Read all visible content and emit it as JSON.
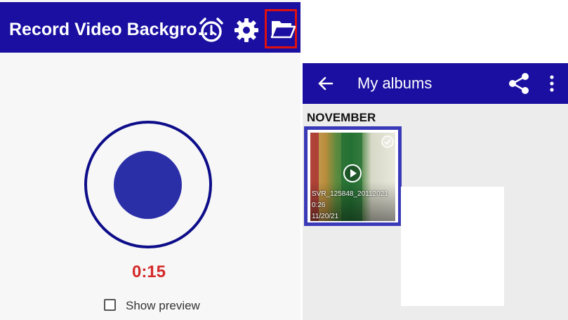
{
  "colors": {
    "appbar": "#1a0fa0",
    "record_ring": "#0d0d8a",
    "record_dot": "#2a2fa8",
    "timer": "#d42a2a",
    "highlight_red": "#e01010",
    "selection_blue": "#3a3ab8"
  },
  "recorder": {
    "title": "Record Video Backgro…",
    "icons": [
      "alarm-icon",
      "gear-icon",
      "folder-open-icon"
    ],
    "timer": "0:15",
    "show_preview_label": "Show preview",
    "show_preview_checked": false
  },
  "albums": {
    "title": "My albums",
    "icons": [
      "back-arrow-icon",
      "share-icon",
      "more-vert-icon"
    ],
    "section": "NOVEMBER",
    "items": [
      {
        "name": "SVR_125848_20112021",
        "duration": "0:26",
        "date": "11/20/21",
        "selected": true
      }
    ]
  }
}
